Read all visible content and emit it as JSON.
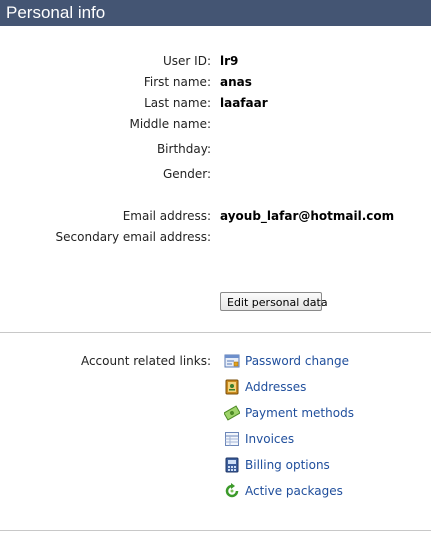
{
  "header": {
    "title": "Personal info"
  },
  "fields": {
    "user_id": {
      "label": "User ID:",
      "value": "lr9"
    },
    "first_name": {
      "label": "First name:",
      "value": "anas"
    },
    "last_name": {
      "label": "Last name:",
      "value": "laafaar"
    },
    "middle_name": {
      "label": "Middle name:",
      "value": ""
    },
    "birthday": {
      "label": "Birthday:",
      "value": ""
    },
    "gender": {
      "label": "Gender:",
      "value": ""
    },
    "email": {
      "label": "Email address:",
      "value": "ayoub_lafar@hotmail.com"
    },
    "secondary_email": {
      "label": "Secondary email address:",
      "value": ""
    }
  },
  "actions": {
    "edit_label": "Edit personal data"
  },
  "account_links": {
    "label": "Account related links:",
    "items": [
      {
        "label": "Password change",
        "icon": "password-form-icon"
      },
      {
        "label": "Addresses",
        "icon": "address-book-icon"
      },
      {
        "label": "Payment methods",
        "icon": "money-icon"
      },
      {
        "label": "Invoices",
        "icon": "invoice-icon"
      },
      {
        "label": "Billing options",
        "icon": "billing-icon"
      },
      {
        "label": "Active packages",
        "icon": "refresh-package-icon"
      }
    ]
  },
  "colors": {
    "header_bg": "#445573",
    "link": "#1f4e9c"
  }
}
